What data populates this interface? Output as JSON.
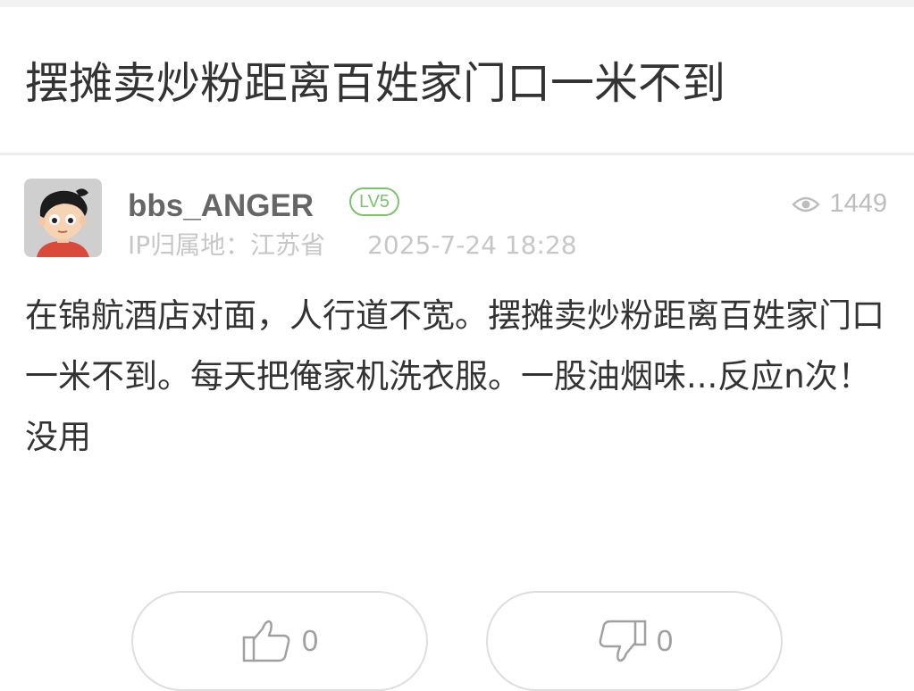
{
  "post": {
    "title": "摆摊卖炒粉距离百姓家门口一米不到",
    "author": {
      "name": "bbs_ANGER",
      "level": "LV5",
      "ip_location": "IP归属地：江苏省",
      "time": "2025-7-24 18:28"
    },
    "views": "1449",
    "content": "在锦航酒店对面，人行道不宽。摆摊卖炒粉距离百姓家门口一米不到。每天把俺家机洗衣服。一股油烟味...反应n次！没用"
  },
  "actions": {
    "like_count": "0",
    "dislike_count": "0"
  },
  "icons": {
    "views": "eye-icon",
    "like": "thumbs-up-icon",
    "dislike": "thumbs-down-icon"
  },
  "colors": {
    "level_badge": "#7cc36b",
    "muted_text": "#c7c7c7",
    "button_border": "#dedede"
  }
}
